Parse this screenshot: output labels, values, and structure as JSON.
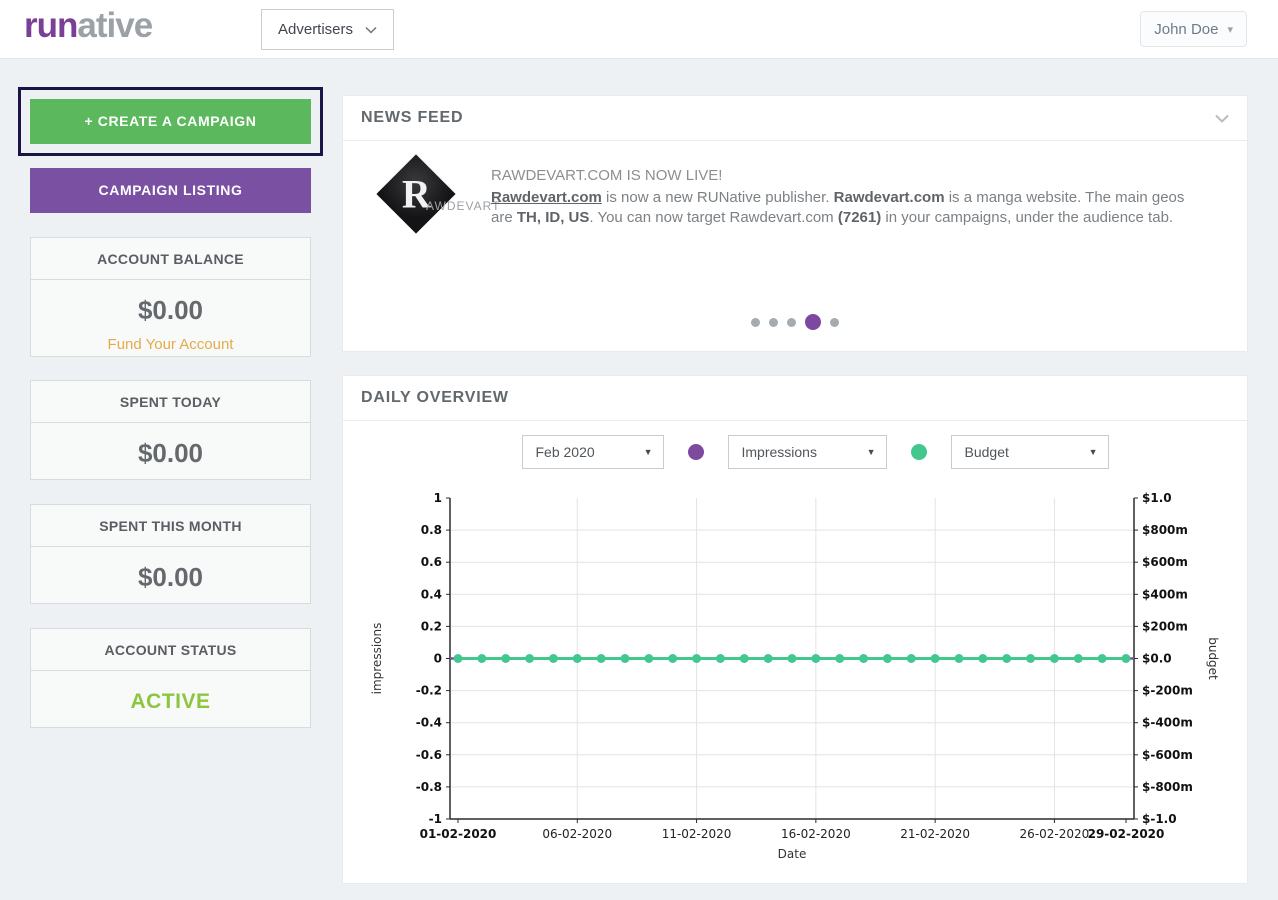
{
  "header": {
    "logo_run": "run",
    "logo_ative": "ative",
    "role_selector": "Advertisers",
    "user_menu": "John Doe"
  },
  "sidebar": {
    "create_campaign": "+ CREATE A CAMPAIGN",
    "campaign_listing": "CAMPAIGN LISTING",
    "cards": [
      {
        "title": "ACCOUNT BALANCE",
        "value": "$0.00",
        "link": "Fund Your Account"
      },
      {
        "title": "SPENT TODAY",
        "value": "$0.00"
      },
      {
        "title": "SPENT THIS MONTH",
        "value": "$0.00"
      },
      {
        "title": "ACCOUNT STATUS",
        "value": "ACTIVE"
      }
    ],
    "status_color": "#8cc63f",
    "link_color": "#e5ab49"
  },
  "news_feed": {
    "title": "NEWS FEED",
    "item": {
      "image_letter": "R",
      "image_word": "AWDEVART",
      "headline": "RAWDEVART.COM IS NOW LIVE!",
      "body_parts": [
        {
          "t": "Rawdevart.com",
          "b": true,
          "u": true
        },
        {
          "t": " is now a new RUNative publisher. "
        },
        {
          "t": "Rawdevart.com",
          "b": true
        },
        {
          "t": " is a manga website. The main geos are "
        },
        {
          "t": "TH, ID, US",
          "b": true
        },
        {
          "t": ". You can now target Rawdevart.com "
        },
        {
          "t": "(7261)",
          "b": true
        },
        {
          "t": " in your campaigns, under the audience tab."
        }
      ]
    },
    "dots": {
      "count": 5,
      "active_index": 3
    }
  },
  "daily_overview": {
    "title": "DAILY OVERVIEW",
    "controls": {
      "month": "Feb 2020",
      "metric_left": "Impressions",
      "metric_right": "Budget"
    },
    "colors": {
      "impressions": "#7d4a9e",
      "budget": "#42c78f"
    }
  },
  "chart_data": {
    "type": "line",
    "title": "DAILY OVERVIEW",
    "xlabel": "Date",
    "x": [
      1,
      2,
      3,
      4,
      5,
      6,
      7,
      8,
      9,
      10,
      11,
      12,
      13,
      14,
      15,
      16,
      17,
      18,
      19,
      20,
      21,
      22,
      23,
      24,
      25,
      26,
      27,
      28,
      29
    ],
    "x_range": [
      1,
      29
    ],
    "x_tick_days": [
      1,
      6,
      11,
      16,
      21,
      26,
      29
    ],
    "x_ticks": [
      "01-02-2020",
      "06-02-2020",
      "11-02-2020",
      "16-02-2020",
      "21-02-2020",
      "26-02-2020",
      "29-02-2020"
    ],
    "left_axis": {
      "label": "impressions",
      "range": [
        -1,
        1
      ],
      "tick_values": [
        1,
        0.8,
        0.6,
        0.4,
        0.2,
        0,
        -0.2,
        -0.4,
        -0.6,
        -0.8,
        -1
      ],
      "ticks": [
        "1",
        "0.8",
        "0.6",
        "0.4",
        "0.2",
        "0",
        "-0.2",
        "-0.4",
        "-0.6",
        "-0.8",
        "-1"
      ]
    },
    "right_axis": {
      "label": "budget",
      "range": [
        -1,
        1
      ],
      "ticks": [
        "$1.0",
        "$800m",
        "$600m",
        "$400m",
        "$200m",
        "$0.0",
        "$-200m",
        "$-400m",
        "$-600m",
        "$-800m",
        "$-1.0"
      ]
    },
    "grid": true,
    "legend_position": "none",
    "series": [
      {
        "name": "Impressions",
        "axis": "left",
        "color": "#7d4a9e",
        "values": [
          0,
          0,
          0,
          0,
          0,
          0,
          0,
          0,
          0,
          0,
          0,
          0,
          0,
          0,
          0,
          0,
          0,
          0,
          0,
          0,
          0,
          0,
          0,
          0,
          0,
          0,
          0,
          0,
          0
        ]
      },
      {
        "name": "Budget",
        "axis": "right",
        "color": "#42c78f",
        "values": [
          0,
          0,
          0,
          0,
          0,
          0,
          0,
          0,
          0,
          0,
          0,
          0,
          0,
          0,
          0,
          0,
          0,
          0,
          0,
          0,
          0,
          0,
          0,
          0,
          0,
          0,
          0,
          0,
          0
        ]
      }
    ]
  }
}
